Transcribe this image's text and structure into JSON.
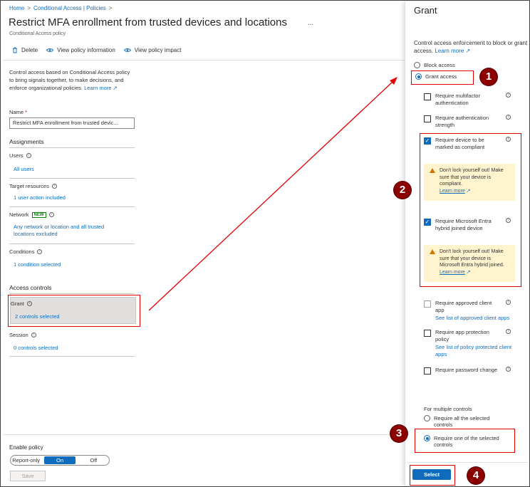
{
  "breadcrumb": {
    "home": "Home",
    "section": "Conditional Access | Policies"
  },
  "page": {
    "title": "Restrict MFA enrollment from trusted devices and locations",
    "more": "...",
    "subtitle": "Conditional Access policy"
  },
  "toolbar": {
    "delete": "Delete",
    "view_info": "View policy information",
    "view_impact": "View policy impact"
  },
  "description": {
    "text": "Control access based on Conditional Access policy to bring signals together, to make decisions, and enforce organizational policies.",
    "learn_more": "Learn more"
  },
  "name_field": {
    "label": "Name",
    "required": "*",
    "value": "Restrict MFA enrollment from trusted devic..."
  },
  "assignments": {
    "heading": "Assignments",
    "users": {
      "label": "Users",
      "value": "All users"
    },
    "target_resources": {
      "label": "Target resources",
      "value": "1 user action included"
    },
    "network": {
      "label": "Network",
      "badge": "NEW",
      "value": "Any network or location and all trusted locations excluded"
    },
    "conditions": {
      "label": "Conditions",
      "value": "1 condition selected"
    }
  },
  "access_controls": {
    "heading": "Access controls",
    "grant": {
      "label": "Grant",
      "value": "2 controls selected"
    },
    "session": {
      "label": "Session",
      "value": "0 controls selected"
    }
  },
  "enable_policy": {
    "label": "Enable policy",
    "options": [
      "Report-only",
      "On",
      "Off"
    ],
    "selected": "On",
    "save": "Save"
  },
  "grant_panel": {
    "title": "Grant",
    "description": "Control access enforcement to block or grant access.",
    "learn_more": "Learn more",
    "block_access": "Block access",
    "grant_access": "Grant access",
    "controls": {
      "mfa": "Require multifactor authentication",
      "auth_strength": "Require authentication strength",
      "compliant": "Require device to be marked as compliant",
      "hybrid": "Require Microsoft Entra hybrid joined device",
      "approved_app": "Require approved client app",
      "approved_app_link": "See list of approved client apps",
      "app_protection": "Require app protection policy",
      "app_protection_link": "See list of policy protected client apps",
      "password_change": "Require password change"
    },
    "warn_compliant": "Don't lock yourself out! Make sure that your device is compliant.",
    "warn_hybrid": "Don't lock yourself out! Make sure that your device is Microsoft Entra hybrid joined.",
    "warn_learn_more": "Learn more",
    "multiple_heading": "For multiple controls",
    "require_all": "Require all the selected controls",
    "require_one": "Require one of the selected controls",
    "select_button": "Select"
  },
  "callouts": [
    "1",
    "2",
    "3",
    "4"
  ],
  "colors": {
    "accent": "#0f6cbd",
    "highlight": "#e00000",
    "badge": "#8b0000",
    "warning_bg": "#fff4ce"
  },
  "icons": [
    "trash-icon",
    "eye-icon",
    "info-icon",
    "external-link-icon",
    "warning-icon",
    "checkmark-icon"
  ]
}
